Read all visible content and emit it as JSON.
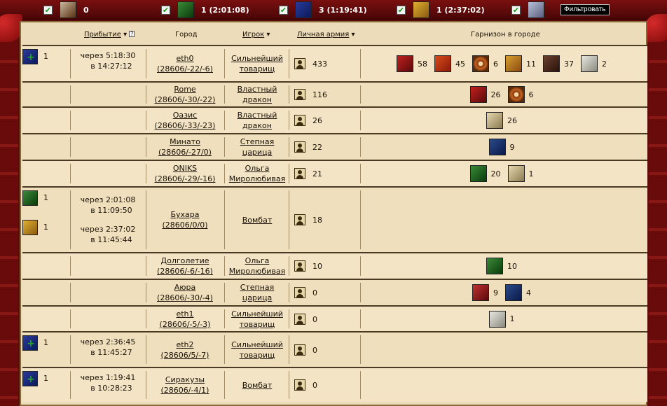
{
  "filters": [
    {
      "label": "0",
      "icon": "small-sword-icon"
    },
    {
      "label": "1 (2:01:08)",
      "icon": "green-sword-icon"
    },
    {
      "label": "3 (1:19:41)",
      "icon": "blue-shield-icon"
    },
    {
      "label": "1 (2:37:02)",
      "icon": "gold-shield-icon"
    },
    {
      "label": "",
      "icon": "crossed-swords-icon"
    }
  ],
  "filter_button": "Фильтровать",
  "headers": {
    "arrival": "Прибытие",
    "city": "Город",
    "player": "Игрок",
    "army": "Личная армия",
    "garrison": "Гарнизон в городе"
  },
  "rows": [
    {
      "arrivals": [
        {
          "icon": "blue-shield-icon",
          "count": "1",
          "in": "через 5:18:30",
          "at": "в 14:27:12"
        }
      ],
      "city": "eth0",
      "coords": "(28606/-22/-6)",
      "player1": "Сильнейший",
      "player2": "товарищ",
      "army": "433",
      "garrison": [
        {
          "icon": "boot-icon",
          "count": "58"
        },
        {
          "icon": "pitchfork-icon",
          "count": "45"
        },
        {
          "icon": "wheel-icon",
          "count": "6"
        },
        {
          "icon": "scroll-icon",
          "count": "11"
        },
        {
          "icon": "horse-icon",
          "count": "37"
        },
        {
          "icon": "shovel-icon",
          "count": "2"
        }
      ]
    },
    {
      "arrivals": [],
      "city": "Rome",
      "coords": "(28606/-30/-22)",
      "player1": "Властный",
      "player2": "дракон",
      "army": "116",
      "garrison": [
        {
          "icon": "boot-icon",
          "count": "26"
        },
        {
          "icon": "wheel-icon",
          "count": "6"
        }
      ]
    },
    {
      "arrivals": [],
      "city": "Оазис",
      "coords": "(28606/-33/-23)",
      "player1": "Властный",
      "player2": "дракон",
      "army": "26",
      "garrison": [
        {
          "icon": "spear-icon",
          "count": "26"
        }
      ]
    },
    {
      "arrivals": [],
      "city": "Минато",
      "coords": "(28606/-27/0)",
      "player1": "Степная",
      "player2": "царица",
      "army": "22",
      "garrison": [
        {
          "icon": "arrow-icon",
          "count": "9"
        }
      ]
    },
    {
      "arrivals": [],
      "city": "ONIKS",
      "coords": "(28606/-29/-16)",
      "player1": "Ольга",
      "player2": "Миролюбивая",
      "army": "21",
      "garrison": [
        {
          "icon": "sword-icon",
          "count": "20"
        },
        {
          "icon": "spear-icon",
          "count": "1"
        }
      ]
    },
    {
      "arrivals": [
        {
          "icon": "green-sword-icon",
          "count": "1",
          "in": "через 2:01:08",
          "at": "в 11:09:50"
        },
        {
          "icon": "gold-shield-icon",
          "count": "1",
          "in": "через 2:37:02",
          "at": "в 11:45:44"
        }
      ],
      "city": "Бухара",
      "coords": "(28606/0/0)",
      "player1": "Вомбат",
      "player2": "",
      "army": "18",
      "garrison": []
    },
    {
      "arrivals": [],
      "city": "Долголетие",
      "coords": "(28606/-6/-16)",
      "player1": "Ольга",
      "player2": "Миролюбивая",
      "army": "10",
      "garrison": [
        {
          "icon": "sword-icon",
          "count": "10"
        }
      ]
    },
    {
      "arrivals": [],
      "city": "Аюра",
      "coords": "(28606/-30/-4)",
      "player1": "Степная",
      "player2": "царица",
      "army": "0",
      "garrison": [
        {
          "icon": "helmet-icon",
          "count": "9"
        },
        {
          "icon": "arrow-icon",
          "count": "4"
        }
      ]
    },
    {
      "arrivals": [],
      "city": "eth1",
      "coords": "(28606/-5/-3)",
      "player1": "Сильнейший",
      "player2": "товарищ",
      "army": "0",
      "garrison": [
        {
          "icon": "shovel-icon",
          "count": "1"
        }
      ]
    },
    {
      "arrivals": [
        {
          "icon": "blue-shield-icon",
          "count": "1",
          "in": "через 2:36:45",
          "at": "в 11:45:27"
        }
      ],
      "city": "eth2",
      "coords": "(28606/5/-7)",
      "player1": "Сильнейший",
      "player2": "товарищ",
      "army": "0",
      "garrison": []
    },
    {
      "arrivals": [
        {
          "icon": "blue-shield-icon",
          "count": "1",
          "in": "через 1:19:41",
          "at": "в 10:28:23"
        }
      ],
      "city": "Сиракузы",
      "coords": "(28606/-4/1)",
      "player1": "Вомбат",
      "player2": "",
      "army": "0",
      "garrison": []
    }
  ]
}
